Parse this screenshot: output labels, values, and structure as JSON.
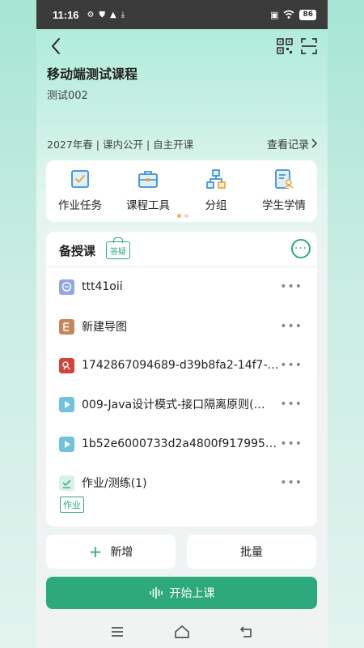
{
  "statusbar": {
    "time": "11:16",
    "battery": "86"
  },
  "course": {
    "title": "移动端测试课程",
    "subtitle": "测试002",
    "meta": "2027年春 | 课内公开 | 自主开课",
    "records_link": "查看记录"
  },
  "tools": [
    {
      "label": "作业任务",
      "icon": "homework-icon"
    },
    {
      "label": "课程工具",
      "icon": "toolbox-icon"
    },
    {
      "label": "分组",
      "icon": "group-icon"
    },
    {
      "label": "学生学情",
      "icon": "student-report-icon"
    }
  ],
  "lesson": {
    "title": "备授课",
    "qa_badge": "答疑",
    "items": [
      {
        "name": "ttt41oii",
        "type": "discussion",
        "color": "#8fa7e3"
      },
      {
        "name": "新建导图",
        "type": "mindmap",
        "color": "#c8875a"
      },
      {
        "name": "1742867094689-d39b8fa2-14f7-…",
        "type": "pdf",
        "color": "#d2443b"
      },
      {
        "name": "009-Java设计模式-接口隔离原则(…",
        "type": "video",
        "color": "#6fc4dc"
      },
      {
        "name": "1b52e6000733d2a4800f9179950…",
        "type": "video",
        "color": "#6fc4dc"
      },
      {
        "name": "作业/测练(1)",
        "type": "homework",
        "color": "#9fdbc4"
      }
    ],
    "homework_tag": "作业"
  },
  "actions": {
    "add": "新增",
    "batch": "批量",
    "start": "开始上课"
  },
  "colors": {
    "accent": "#2ea97d"
  }
}
